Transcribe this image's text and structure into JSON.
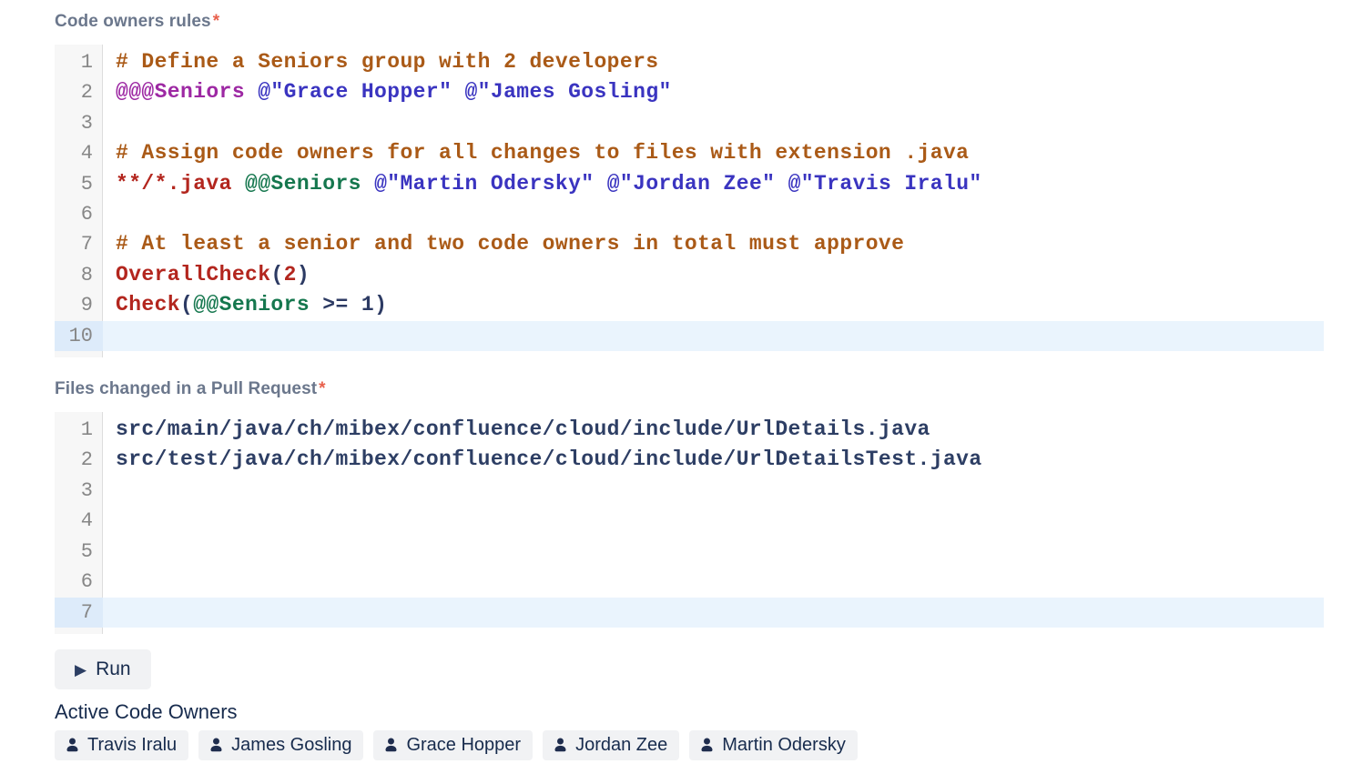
{
  "editors": [
    {
      "id": "code-owners-rules",
      "label": "Code owners rules",
      "required_marker": "*",
      "active_line": 10,
      "lines": [
        {
          "n": 1,
          "tokens": [
            [
              "comment",
              "# Define a Seniors group with 2 developers"
            ]
          ]
        },
        {
          "n": 2,
          "tokens": [
            [
              "atom",
              "@@@Seniors"
            ],
            [
              "plain",
              " "
            ],
            [
              "owner",
              "@\"Grace Hopper\""
            ],
            [
              "plain",
              " "
            ],
            [
              "owner",
              "@\"James Gosling\""
            ]
          ]
        },
        {
          "n": 3,
          "tokens": []
        },
        {
          "n": 4,
          "tokens": [
            [
              "comment",
              "# Assign code owners for all changes to files with extension .java"
            ]
          ]
        },
        {
          "n": 5,
          "tokens": [
            [
              "pattern",
              "**/*.java"
            ],
            [
              "plain",
              " "
            ],
            [
              "group",
              "@@Seniors"
            ],
            [
              "plain",
              " "
            ],
            [
              "owner",
              "@\"Martin Odersky\""
            ],
            [
              "plain",
              " "
            ],
            [
              "owner",
              "@\"Jordan Zee\""
            ],
            [
              "plain",
              " "
            ],
            [
              "owner",
              "@\"Travis Iralu\""
            ]
          ]
        },
        {
          "n": 6,
          "tokens": []
        },
        {
          "n": 7,
          "tokens": [
            [
              "comment",
              "# At least a senior and two code owners in total must approve"
            ]
          ]
        },
        {
          "n": 8,
          "tokens": [
            [
              "func",
              "OverallCheck"
            ],
            [
              "punct",
              "("
            ],
            [
              "number",
              "2"
            ],
            [
              "punct",
              ")"
            ]
          ]
        },
        {
          "n": 9,
          "tokens": [
            [
              "func",
              "Check"
            ],
            [
              "punct",
              "("
            ],
            [
              "group",
              "@@Seniors"
            ],
            [
              "plain",
              " "
            ],
            [
              "punct",
              ">="
            ],
            [
              "plain",
              " "
            ],
            [
              "punct",
              "1"
            ],
            [
              "punct",
              ")"
            ]
          ]
        },
        {
          "n": 10,
          "tokens": []
        }
      ]
    },
    {
      "id": "files-changed",
      "label": "Files changed in a Pull Request",
      "required_marker": "*",
      "active_line": 7,
      "lines": [
        {
          "n": 1,
          "tokens": [
            [
              "path",
              "src/main/java/ch/mibex/confluence/cloud/include/UrlDetails.java"
            ]
          ]
        },
        {
          "n": 2,
          "tokens": [
            [
              "path",
              "src/test/java/ch/mibex/confluence/cloud/include/UrlDetailsTest.java"
            ]
          ]
        },
        {
          "n": 3,
          "tokens": []
        },
        {
          "n": 4,
          "tokens": []
        },
        {
          "n": 5,
          "tokens": []
        },
        {
          "n": 6,
          "tokens": []
        },
        {
          "n": 7,
          "tokens": []
        }
      ]
    }
  ],
  "run_button": {
    "label": "Run",
    "icon": "play-icon"
  },
  "owners_section": {
    "title": "Active Code Owners",
    "owner_icon": "person-icon",
    "owners": [
      "Travis Iralu",
      "James Gosling",
      "Grace Hopper",
      "Jordan Zee",
      "Martin Odersky"
    ]
  },
  "colors": {
    "label": "#6B778C",
    "required": "#e8604c",
    "text_dark": "#172B4D",
    "chip_bg": "#f1f2f4",
    "gutter_bg": "#f7f7f7",
    "gutter_border": "#dddddd",
    "line_number": "#878787",
    "active_line_bg": "#eaf4fd",
    "active_gutter_bg": "#ddebfa",
    "syntax": {
      "comment": "#aa5a17",
      "atom": "#9d28a3",
      "owner": "#3a34c0",
      "pattern": "#b3261e",
      "group": "#15774e",
      "func": "#b3261e",
      "number": "#b3261e",
      "punct": "#2c3a63",
      "plain": "#2c3a63",
      "path": "#2d3e64"
    }
  }
}
